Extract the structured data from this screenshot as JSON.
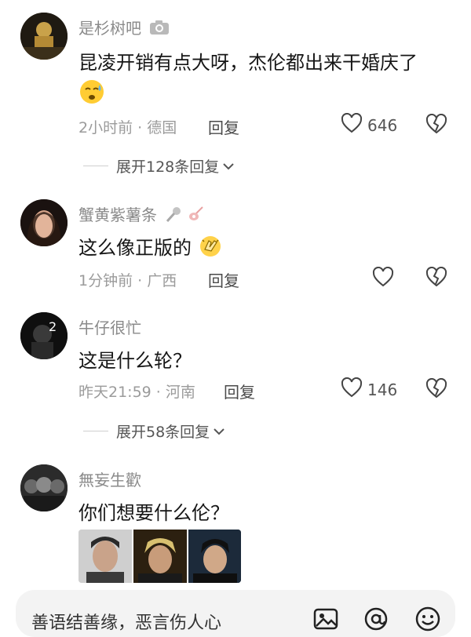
{
  "comments": [
    {
      "username": "是杉树吧",
      "text": "昆凌开销有点大呀，杰伦都出来干婚庆了",
      "time_location": "2小时前 · 德国",
      "reply_label": "回复",
      "likes": "646",
      "expand_label": "展开128条回复"
    },
    {
      "username": "蟹黄紫薯条",
      "text": "这么像正版的",
      "time_location": "1分钟前 · 广西",
      "reply_label": "回复",
      "likes": ""
    },
    {
      "username": "牛仔很忙",
      "text": "这是什么轮？",
      "time_location": "昨天21:59 · 河南",
      "reply_label": "回复",
      "likes": "146",
      "expand_label": "展开58条回复"
    },
    {
      "username": "無妄生歡",
      "text": "你们想要什么伦？",
      "time_location": "",
      "reply_label": "",
      "likes": ""
    }
  ],
  "input": {
    "placeholder": "善语结善缘，恶言伤人心"
  },
  "icons": [
    "camera-icon",
    "emoji-sweat-icon",
    "microphone-icon",
    "guitar-icon",
    "emoji-clap-icon",
    "heart-icon",
    "broken-heart-icon",
    "chevron-down-icon",
    "image-icon",
    "at-icon",
    "smiley-icon"
  ]
}
